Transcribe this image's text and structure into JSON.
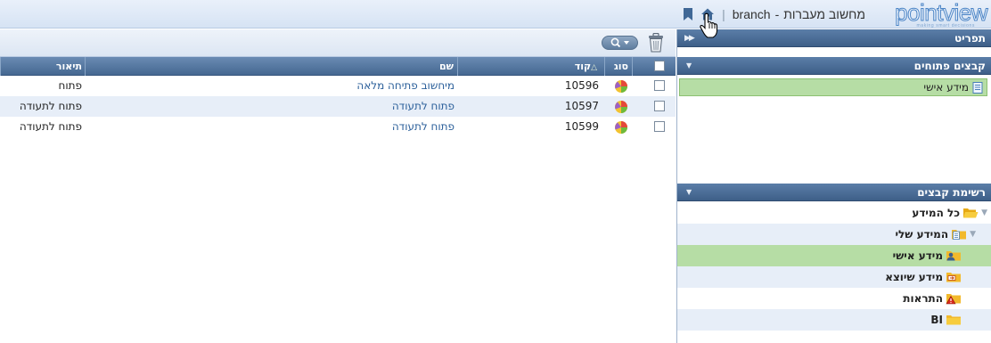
{
  "header": {
    "brand_name": "pointview",
    "brand_tagline": "making smart decisions",
    "app_name": "מחשוב מעברות",
    "title_separator": "-",
    "branch": "branch",
    "divider": "|"
  },
  "sidebar": {
    "menu_title": "תפריט",
    "open_files_title": "קבצים פתוחים",
    "open_files": [
      {
        "label": "מידע אישי"
      }
    ],
    "files_list_title": "רשימת קבצים",
    "tree": [
      {
        "label": "כל המידע"
      },
      {
        "label": "המידע שלי"
      },
      {
        "label": "מידע אישי"
      },
      {
        "label": "מידע שיוצא"
      },
      {
        "label": "התראות"
      },
      {
        "label": "BI"
      }
    ]
  },
  "grid": {
    "columns": {
      "type": "סוג",
      "code": "קוד",
      "name": "שם",
      "description": "תיאור"
    },
    "rows": [
      {
        "code": "10596",
        "name": "מיחשוב פתיחה מלאה",
        "description": "פתוח"
      },
      {
        "code": "10597",
        "name": "פתוח לתעודה",
        "description": "פתוח לתעודה"
      },
      {
        "code": "10599",
        "name": "פתוח לתעודה",
        "description": "פתוח לתעודה"
      }
    ]
  },
  "colors": {
    "header_blue": "#456891",
    "selection_green": "#b6dda5",
    "link_blue": "#2b5f9a",
    "row_alt": "#e7eef8"
  },
  "icons": {
    "home": "home-icon",
    "bookmark": "bookmark-icon",
    "trash": "trash-icon",
    "search": "search-icon",
    "folder": "folder-icon",
    "report_type": "pie-chart-icon"
  }
}
